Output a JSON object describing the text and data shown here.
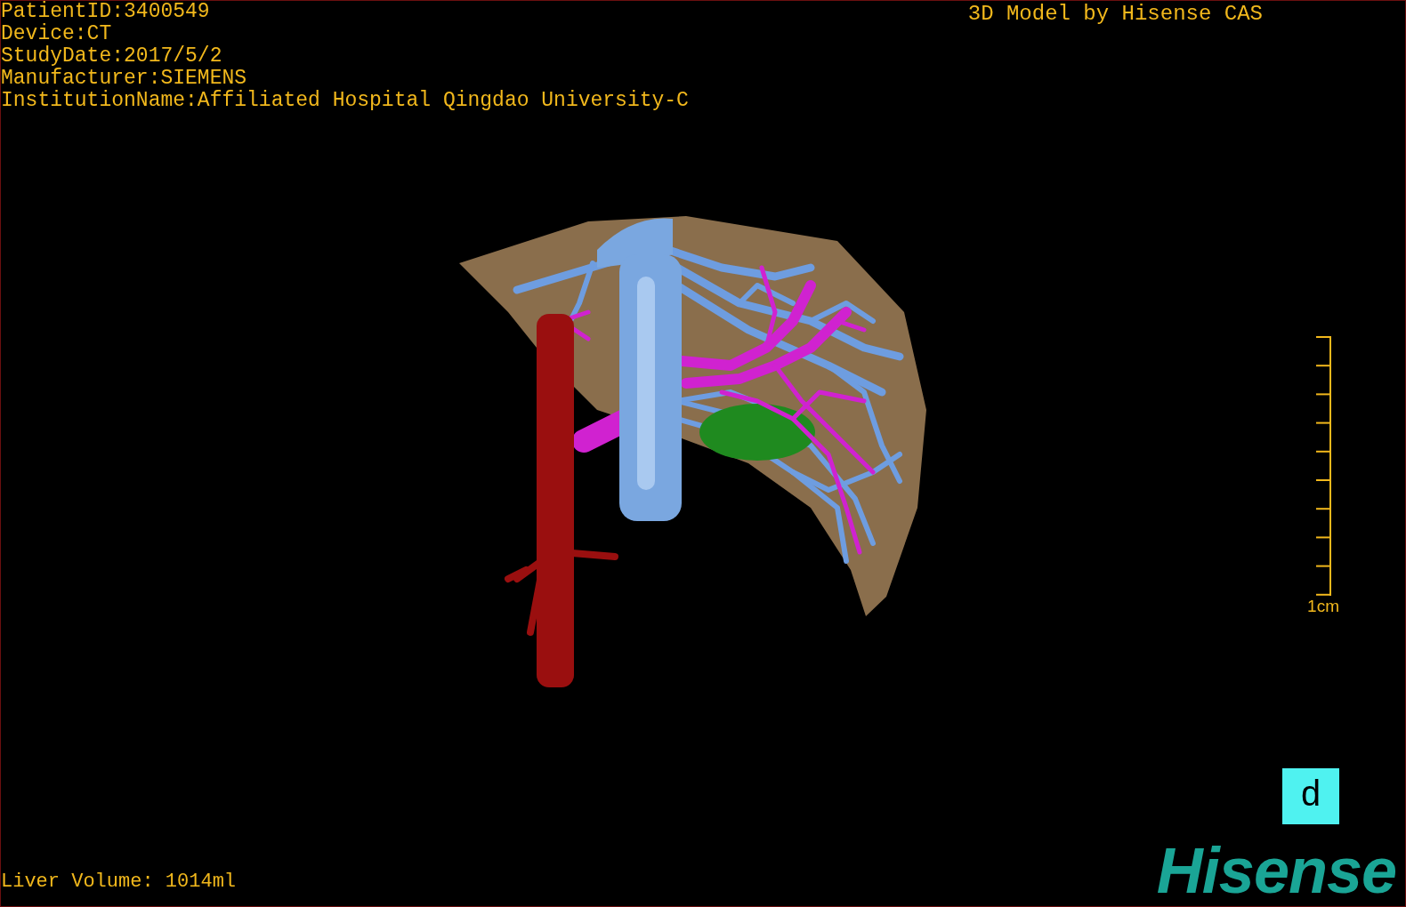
{
  "patient_info": [
    "PatientID:3400549",
    "Device:CT",
    "StudyDate:2017/5/2",
    "Manufacturer:SIEMENS",
    "InstitutionName:Affiliated Hospital Qingdao University-C"
  ],
  "title": "3D Model by Hisense CAS",
  "scale_label": "1cm",
  "orientation_marker": "d",
  "logo": "Hisense",
  "liver_volume": "Liver Volume: 1014ml"
}
